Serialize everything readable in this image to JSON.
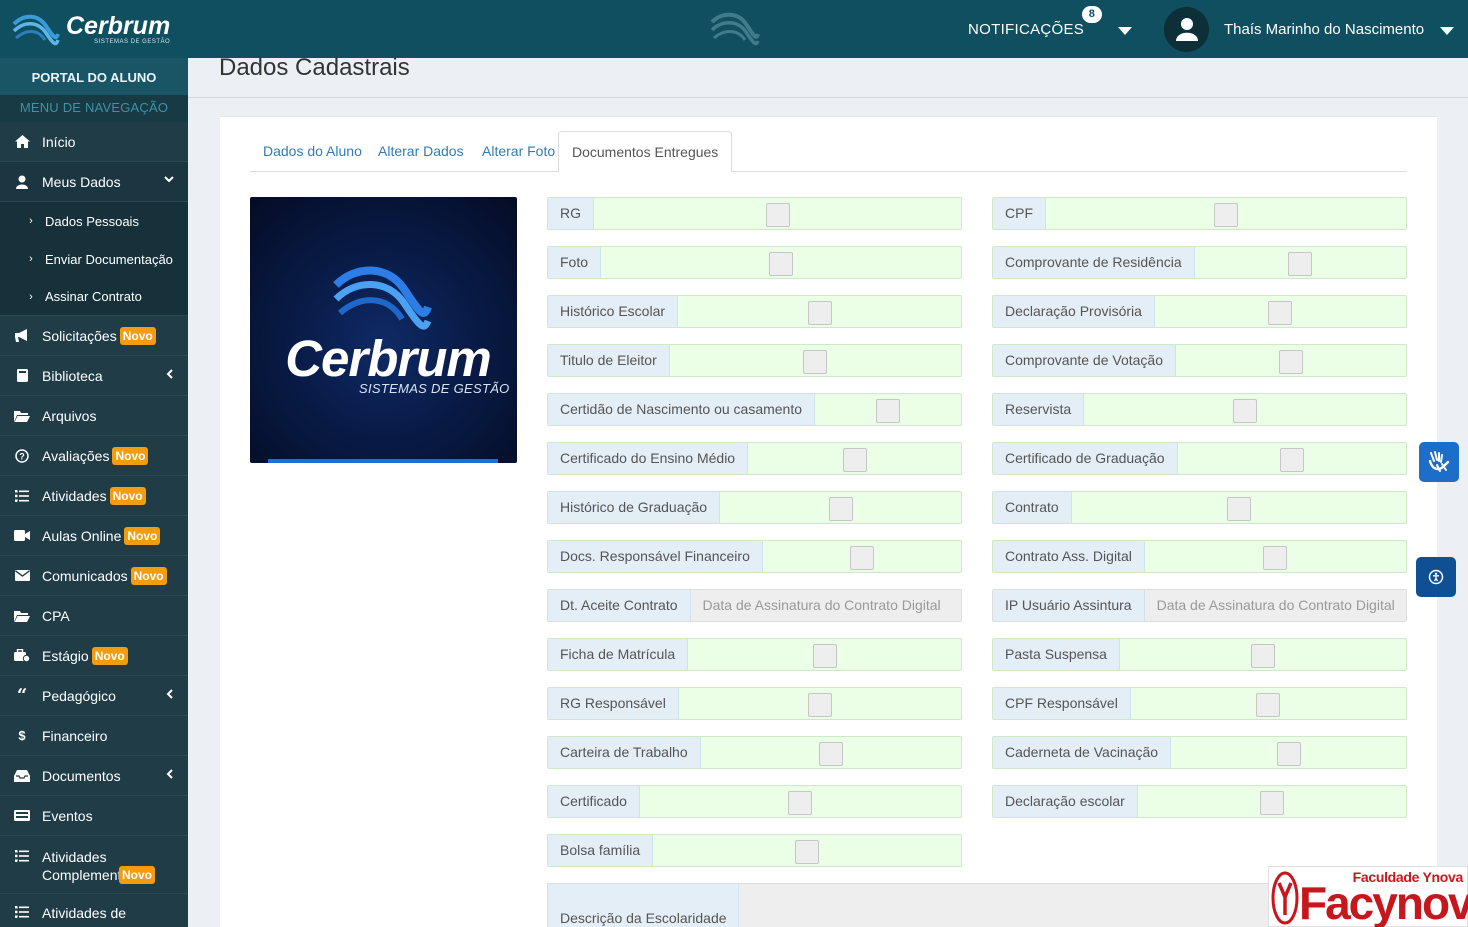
{
  "brand": {
    "name": "Cerbrum",
    "tagline": "SISTEMAS DE GESTÃO"
  },
  "sidebar": {
    "portal_label": "PORTAL DO ALUNO",
    "menu_label": "MENU DE NAVEGAÇÃO",
    "items": [
      {
        "label": "Início",
        "icon": "home-icon"
      },
      {
        "label": "Meus Dados",
        "icon": "user-icon",
        "expanded": true
      },
      {
        "label": "Dados Pessoais",
        "icon": "chevron-right-icon"
      },
      {
        "label": "Enviar Documentação",
        "icon": "chevron-right-icon"
      },
      {
        "label": "Assinar Contrato",
        "icon": "chevron-right-icon"
      },
      {
        "label": "Solicitações",
        "icon": "bullhorn-icon",
        "badge": "Novo"
      },
      {
        "label": "Biblioteca",
        "icon": "book-icon"
      },
      {
        "label": "Arquivos",
        "icon": "folder-icon"
      },
      {
        "label": "Avaliações",
        "icon": "question-icon",
        "badge": "Novo"
      },
      {
        "label": "Atividades",
        "icon": "list-icon",
        "badge": "Novo"
      },
      {
        "label": "Aulas Online",
        "icon": "video-icon",
        "badge": "Novo"
      },
      {
        "label": "Comunicados",
        "icon": "envelope-icon",
        "badge": "Novo"
      },
      {
        "label": "CPA",
        "icon": "folder-icon"
      },
      {
        "label": "Estágio",
        "icon": "briefcase-icon",
        "badge": "Novo"
      },
      {
        "label": "Pedagógico",
        "icon": "quote-icon"
      },
      {
        "label": "Financeiro",
        "icon": "dollar-icon"
      },
      {
        "label": "Documentos",
        "icon": "inbox-icon"
      },
      {
        "label": "Eventos",
        "icon": "keyboard-icon"
      },
      {
        "label": "Atividades Complementares",
        "icon": "list-icon",
        "badge": "Novo"
      },
      {
        "label": "Atividades de",
        "icon": "list-icon"
      }
    ]
  },
  "header": {
    "notifications_label": "NOTIFICAÇÕES",
    "notifications_count": "8",
    "user_name": "Thaís Marinho do Nascimento"
  },
  "page": {
    "title": "Dados Cadastrais",
    "tabs": [
      "Dados do Aluno",
      "Alterar Dados",
      "Alterar Foto",
      "Documentos Entregues"
    ],
    "photo": {
      "title": "Cerbrum",
      "subtitle": "SISTEMAS DE GESTÃO"
    },
    "left_fields": [
      "RG",
      "Foto",
      "Histórico Escolar",
      "Titulo de Eleitor",
      "Certidão de Nascimento ou casamento",
      "Certificado do Ensino Médio",
      "Histórico de Graduação",
      "Docs. Responsável Financeiro",
      "Dt. Aceite Contrato",
      "Ficha de Matrícula",
      "RG Responsável",
      "Carteira de Trabalho",
      "Certificado",
      "Bolsa família"
    ],
    "right_fields": [
      "CPF",
      "Comprovante de Residência",
      "Declaração Provisória",
      "Comprovante de Votação",
      "Reservista",
      "Certificado de Graduação",
      "Contrato",
      "Contrato Ass. Digital",
      "IP Usuário Assintura",
      "Pasta Suspensa",
      "CPF Responsável",
      "Caderneta de Vacinação",
      "Declaração escolar"
    ],
    "date_placeholder": "Data de Assinatura do Contrato Digital",
    "ip_placeholder": "Data de Assinatura do Contrato Digital",
    "description_label": "Descrição da Escolaridade"
  },
  "watermark": {
    "small": "Faculdade Ynova",
    "big": "Facynova"
  }
}
